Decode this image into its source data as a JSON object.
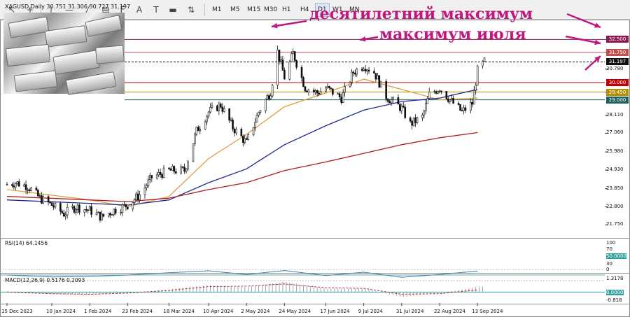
{
  "toolbar": {
    "timeframes": [
      "M1",
      "M5",
      "M15",
      "M30",
      "H1",
      "H4",
      "D1",
      "W1",
      "MN"
    ],
    "active": "D1",
    "tool_icons": [
      "cursor-icon",
      "crosshair-icon",
      "hline-icon",
      "trendline-icon",
      "channel-icon",
      "text-icon",
      "label-icon",
      "rectangle-icon",
      "shapes-icon"
    ]
  },
  "chart_data": {
    "type": "candlestick",
    "symbol_line": "XAGUSD,Daily  30.751 31.306 30.727 31.197",
    "annotations": {
      "ten_year_high": "десятилетний максимум",
      "july_high": "максимум июля"
    },
    "x_dates": [
      "15 Dec 2023",
      "10 Jan 2024",
      "1 Feb 2024",
      "23 Feb 2024",
      "18 Mar 2024",
      "10 Apr 2024",
      "2 May 2024",
      "24 May 2024",
      "17 Jun 2024",
      "9 Jul 2024",
      "31 Jul 2024",
      "22 Aug 2024",
      "13 Sep 2024"
    ],
    "y_ticks": [
      32.5,
      31.75,
      30.78,
      29.45,
      28.11,
      27.06,
      25.98,
      24.93,
      23.85,
      22.8,
      21.75
    ],
    "ylim": [
      21.2,
      33.0
    ],
    "close_path": [
      [
        "15 Dec 2023",
        24.1
      ],
      [
        "20 Dec 2023",
        24.2
      ],
      [
        "27 Dec 2023",
        24.0
      ],
      [
        "3 Jan 2024",
        23.3
      ],
      [
        "10 Jan 2024",
        22.9
      ],
      [
        "17 Jan 2024",
        22.4
      ],
      [
        "24 Jan 2024",
        22.8
      ],
      [
        "1 Feb 2024",
        22.6
      ],
      [
        "8 Feb 2024",
        22.2
      ],
      [
        "15 Feb 2024",
        22.6
      ],
      [
        "23 Feb 2024",
        22.9
      ],
      [
        "1 Mar 2024",
        23.5
      ],
      [
        "8 Mar 2024",
        24.5
      ],
      [
        "18 Mar 2024",
        24.9
      ],
      [
        "27 Mar 2024",
        24.9
      ],
      [
        "3 Apr 2024",
        27.2
      ],
      [
        "10 Apr 2024",
        28.3
      ],
      [
        "17 Apr 2024",
        28.7
      ],
      [
        "24 Apr 2024",
        27.4
      ],
      [
        "2 May 2024",
        26.5
      ],
      [
        "9 May 2024",
        28.3
      ],
      [
        "16 May 2024",
        29.5
      ],
      [
        "20 May 2024",
        31.8
      ],
      [
        "24 May 2024",
        30.3
      ],
      [
        "29 May 2024",
        31.7
      ],
      [
        "5 Jun 2024",
        29.7
      ],
      [
        "12 Jun 2024",
        29.4
      ],
      [
        "17 Jun 2024",
        29.7
      ],
      [
        "26 Jun 2024",
        29.1
      ],
      [
        "3 Jul 2024",
        30.6
      ],
      [
        "9 Jul 2024",
        31.0
      ],
      [
        "15 Jul 2024",
        30.6
      ],
      [
        "22 Jul 2024",
        29.2
      ],
      [
        "31 Jul 2024",
        28.5
      ],
      [
        "5 Aug 2024",
        27.6
      ],
      [
        "12 Aug 2024",
        28.0
      ],
      [
        "16 Aug 2024",
        29.3
      ],
      [
        "22 Aug 2024",
        29.7
      ],
      [
        "28 Aug 2024",
        29.0
      ],
      [
        "4 Sep 2024",
        28.3
      ],
      [
        "10 Sep 2024",
        28.8
      ],
      [
        "13 Sep 2024",
        30.7
      ],
      [
        "17 Sep 2024",
        31.2
      ]
    ],
    "levels": [
      {
        "value": 32.5,
        "label": "32.500",
        "color": "#8b1a4f"
      },
      {
        "value": 31.75,
        "label": "31.750",
        "color": "#c05050"
      },
      {
        "value": 31.197,
        "label": "31.197",
        "color": "#111111"
      },
      {
        "value": 30.0,
        "label": "30.000",
        "color": "#c00000"
      },
      {
        "value": 29.45,
        "label": "29.450",
        "color": "#b58f00"
      },
      {
        "value": 29.0,
        "label": "29.000",
        "color": "#1f5f5f"
      }
    ],
    "moving_averages": [
      {
        "color": "#d9a040",
        "path": [
          [
            "15 Dec 2023",
            23.8
          ],
          [
            "1 Feb 2024",
            23.2
          ],
          [
            "23 Feb 2024",
            22.8
          ],
          [
            "18 Mar 2024",
            23.4
          ],
          [
            "10 Apr 2024",
            25.6
          ],
          [
            "2 May 2024",
            27.0
          ],
          [
            "24 May 2024",
            28.6
          ],
          [
            "17 Jun 2024",
            29.4
          ],
          [
            "9 Jul 2024",
            30.2
          ],
          [
            "31 Jul 2024",
            29.6
          ],
          [
            "22 Aug 2024",
            29.0
          ],
          [
            "13 Sep 2024",
            29.1
          ]
        ]
      },
      {
        "color": "#1f2a8f",
        "path": [
          [
            "15 Dec 2023",
            23.2
          ],
          [
            "1 Feb 2024",
            23.0
          ],
          [
            "23 Feb 2024",
            22.9
          ],
          [
            "18 Mar 2024",
            23.2
          ],
          [
            "10 Apr 2024",
            24.2
          ],
          [
            "2 May 2024",
            25.0
          ],
          [
            "24 May 2024",
            26.4
          ],
          [
            "17 Jun 2024",
            27.5
          ],
          [
            "9 Jul 2024",
            28.4
          ],
          [
            "31 Jul 2024",
            28.9
          ],
          [
            "22 Aug 2024",
            29.1
          ],
          [
            "13 Sep 2024",
            29.6
          ]
        ]
      },
      {
        "color": "#b01c1c",
        "path": [
          [
            "15 Dec 2023",
            23.4
          ],
          [
            "1 Feb 2024",
            23.2
          ],
          [
            "23 Feb 2024",
            23.1
          ],
          [
            "18 Mar 2024",
            23.3
          ],
          [
            "10 Apr 2024",
            23.8
          ],
          [
            "2 May 2024",
            24.2
          ],
          [
            "24 May 2024",
            24.9
          ],
          [
            "17 Jun 2024",
            25.4
          ],
          [
            "9 Jul 2024",
            25.9
          ],
          [
            "31 Jul 2024",
            26.4
          ],
          [
            "22 Aug 2024",
            26.8
          ],
          [
            "13 Sep 2024",
            27.1
          ]
        ]
      }
    ],
    "rsi": {
      "label": "RSI(14) 64.1456",
      "ticks": [
        "100",
        "70",
        "50.0000",
        "30",
        "0"
      ],
      "ylim": [
        0,
        100
      ],
      "path": [
        [
          "15 Dec 2023",
          50
        ],
        [
          "10 Jan 2024",
          43
        ],
        [
          "1 Feb 2024",
          45
        ],
        [
          "23 Feb 2024",
          50
        ],
        [
          "18 Mar 2024",
          58
        ],
        [
          "10 Apr 2024",
          65
        ],
        [
          "2 May 2024",
          52
        ],
        [
          "24 May 2024",
          66
        ],
        [
          "17 Jun 2024",
          48
        ],
        [
          "9 Jul 2024",
          60
        ],
        [
          "31 Jul 2024",
          42
        ],
        [
          "22 Aug 2024",
          52
        ],
        [
          "13 Sep 2024",
          64
        ]
      ]
    },
    "macd": {
      "label": "MACD(12,26,9) 0.5176 0.2093",
      "ticks": [
        "1.3178",
        "0.0000",
        "-0.818"
      ],
      "ylim": [
        -0.818,
        1.3178
      ],
      "histogram": [
        [
          "15 Dec 2023",
          0.05
        ],
        [
          "10 Jan 2024",
          -0.2
        ],
        [
          "1 Feb 2024",
          -0.25
        ],
        [
          "23 Feb 2024",
          -0.1
        ],
        [
          "18 Mar 2024",
          0.25
        ],
        [
          "10 Apr 2024",
          0.65
        ],
        [
          "2 May 2024",
          0.45
        ],
        [
          "24 May 2024",
          0.95
        ],
        [
          "17 Jun 2024",
          0.3
        ],
        [
          "9 Jul 2024",
          0.35
        ],
        [
          "31 Jul 2024",
          -0.45
        ],
        [
          "22 Aug 2024",
          -0.1
        ],
        [
          "13 Sep 2024",
          0.5
        ]
      ],
      "signal": [
        [
          "15 Dec 2023",
          0.0
        ],
        [
          "10 Jan 2024",
          -0.15
        ],
        [
          "1 Feb 2024",
          -0.2
        ],
        [
          "23 Feb 2024",
          -0.1
        ],
        [
          "18 Mar 2024",
          0.15
        ],
        [
          "10 Apr 2024",
          0.5
        ],
        [
          "2 May 2024",
          0.55
        ],
        [
          "24 May 2024",
          0.75
        ],
        [
          "17 Jun 2024",
          0.4
        ],
        [
          "9 Jul 2024",
          0.35
        ],
        [
          "31 Jul 2024",
          -0.2
        ],
        [
          "22 Aug 2024",
          -0.15
        ],
        [
          "13 Sep 2024",
          0.2
        ]
      ]
    }
  }
}
